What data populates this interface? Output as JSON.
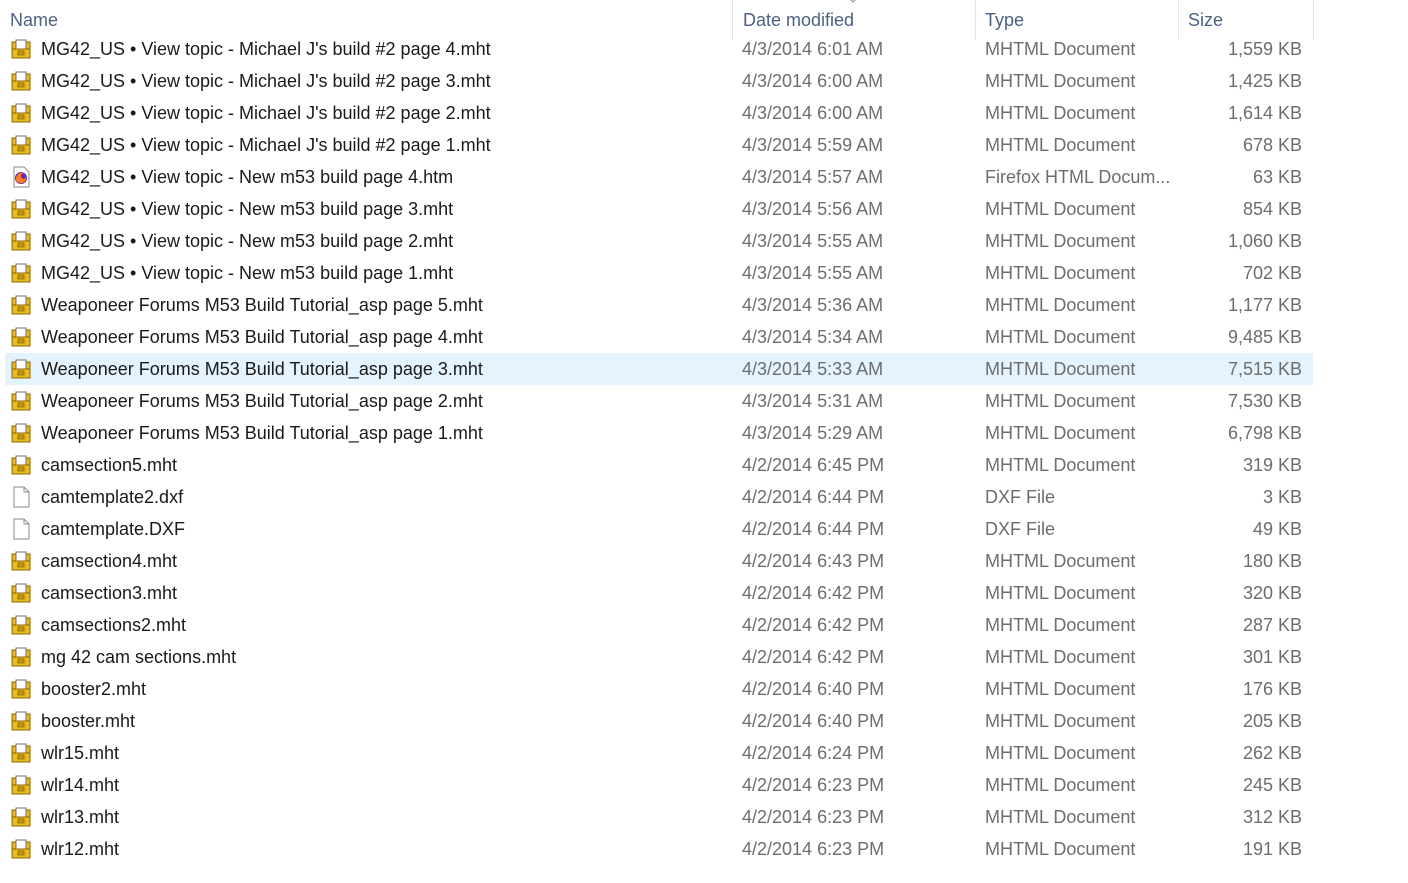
{
  "columns": {
    "name": "Name",
    "date_modified": "Date modified",
    "type": "Type",
    "size": "Size"
  },
  "colors": {
    "header_text": "#4d6182",
    "selected_row": "#e5f3ff",
    "mhtml_icon_fill": "#e8b923",
    "mhtml_icon_border": "#8a6a00"
  },
  "files": [
    {
      "name": "MG42_US • View topic - Michael J's build #2 page 4.mht",
      "date": "4/3/2014 6:01 AM",
      "type": "MHTML Document",
      "size": "1,559 KB",
      "icon": "mhtml-document-icon",
      "selected": false
    },
    {
      "name": "MG42_US • View topic - Michael J's build #2 page 3.mht",
      "date": "4/3/2014 6:00 AM",
      "type": "MHTML Document",
      "size": "1,425 KB",
      "icon": "mhtml-document-icon",
      "selected": false
    },
    {
      "name": "MG42_US • View topic - Michael J's build #2 page 2.mht",
      "date": "4/3/2014 6:00 AM",
      "type": "MHTML Document",
      "size": "1,614 KB",
      "icon": "mhtml-document-icon",
      "selected": false
    },
    {
      "name": "MG42_US • View topic - Michael J's build #2 page 1.mht",
      "date": "4/3/2014 5:59 AM",
      "type": "MHTML Document",
      "size": "678 KB",
      "icon": "mhtml-document-icon",
      "selected": false
    },
    {
      "name": "MG42_US • View topic - New m53 build page 4.htm",
      "date": "4/3/2014 5:57 AM",
      "type": "Firefox HTML Docum...",
      "size": "63 KB",
      "icon": "firefox-document-icon",
      "selected": false
    },
    {
      "name": "MG42_US • View topic - New m53 build page 3.mht",
      "date": "4/3/2014 5:56 AM",
      "type": "MHTML Document",
      "size": "854 KB",
      "icon": "mhtml-document-icon",
      "selected": false
    },
    {
      "name": "MG42_US • View topic - New m53 build page 2.mht",
      "date": "4/3/2014 5:55 AM",
      "type": "MHTML Document",
      "size": "1,060 KB",
      "icon": "mhtml-document-icon",
      "selected": false
    },
    {
      "name": "MG42_US • View topic - New m53 build page 1.mht",
      "date": "4/3/2014 5:55 AM",
      "type": "MHTML Document",
      "size": "702 KB",
      "icon": "mhtml-document-icon",
      "selected": false
    },
    {
      "name": "Weaponeer Forums M53 Build Tutorial_asp page 5.mht",
      "date": "4/3/2014 5:36 AM",
      "type": "MHTML Document",
      "size": "1,177 KB",
      "icon": "mhtml-document-icon",
      "selected": false
    },
    {
      "name": "Weaponeer Forums M53 Build Tutorial_asp page 4.mht",
      "date": "4/3/2014 5:34 AM",
      "type": "MHTML Document",
      "size": "9,485 KB",
      "icon": "mhtml-document-icon",
      "selected": false
    },
    {
      "name": "Weaponeer Forums M53 Build Tutorial_asp page 3.mht",
      "date": "4/3/2014 5:33 AM",
      "type": "MHTML Document",
      "size": "7,515 KB",
      "icon": "mhtml-document-icon",
      "selected": true
    },
    {
      "name": "Weaponeer Forums M53 Build Tutorial_asp page 2.mht",
      "date": "4/3/2014 5:31 AM",
      "type": "MHTML Document",
      "size": "7,530 KB",
      "icon": "mhtml-document-icon",
      "selected": false
    },
    {
      "name": "Weaponeer Forums M53 Build Tutorial_asp page 1.mht",
      "date": "4/3/2014 5:29 AM",
      "type": "MHTML Document",
      "size": "6,798 KB",
      "icon": "mhtml-document-icon",
      "selected": false
    },
    {
      "name": "camsection5.mht",
      "date": "4/2/2014 6:45 PM",
      "type": "MHTML Document",
      "size": "319 KB",
      "icon": "mhtml-document-icon",
      "selected": false
    },
    {
      "name": "camtemplate2.dxf",
      "date": "4/2/2014 6:44 PM",
      "type": "DXF File",
      "size": "3 KB",
      "icon": "blank-file-icon",
      "selected": false
    },
    {
      "name": "camtemplate.DXF",
      "date": "4/2/2014 6:44 PM",
      "type": "DXF File",
      "size": "49 KB",
      "icon": "blank-file-icon",
      "selected": false
    },
    {
      "name": "camsection4.mht",
      "date": "4/2/2014 6:43 PM",
      "type": "MHTML Document",
      "size": "180 KB",
      "icon": "mhtml-document-icon",
      "selected": false
    },
    {
      "name": "camsection3.mht",
      "date": "4/2/2014 6:42 PM",
      "type": "MHTML Document",
      "size": "320 KB",
      "icon": "mhtml-document-icon",
      "selected": false
    },
    {
      "name": "camsections2.mht",
      "date": "4/2/2014 6:42 PM",
      "type": "MHTML Document",
      "size": "287 KB",
      "icon": "mhtml-document-icon",
      "selected": false
    },
    {
      "name": "mg 42 cam sections.mht",
      "date": "4/2/2014 6:42 PM",
      "type": "MHTML Document",
      "size": "301 KB",
      "icon": "mhtml-document-icon",
      "selected": false
    },
    {
      "name": "booster2.mht",
      "date": "4/2/2014 6:40 PM",
      "type": "MHTML Document",
      "size": "176 KB",
      "icon": "mhtml-document-icon",
      "selected": false
    },
    {
      "name": "booster.mht",
      "date": "4/2/2014 6:40 PM",
      "type": "MHTML Document",
      "size": "205 KB",
      "icon": "mhtml-document-icon",
      "selected": false
    },
    {
      "name": "wlr15.mht",
      "date": "4/2/2014 6:24 PM",
      "type": "MHTML Document",
      "size": "262 KB",
      "icon": "mhtml-document-icon",
      "selected": false
    },
    {
      "name": "wlr14.mht",
      "date": "4/2/2014 6:23 PM",
      "type": "MHTML Document",
      "size": "245 KB",
      "icon": "mhtml-document-icon",
      "selected": false
    },
    {
      "name": "wlr13.mht",
      "date": "4/2/2014 6:23 PM",
      "type": "MHTML Document",
      "size": "312 KB",
      "icon": "mhtml-document-icon",
      "selected": false
    },
    {
      "name": "wlr12.mht",
      "date": "4/2/2014 6:23 PM",
      "type": "MHTML Document",
      "size": "191 KB",
      "icon": "mhtml-document-icon",
      "selected": false
    }
  ]
}
